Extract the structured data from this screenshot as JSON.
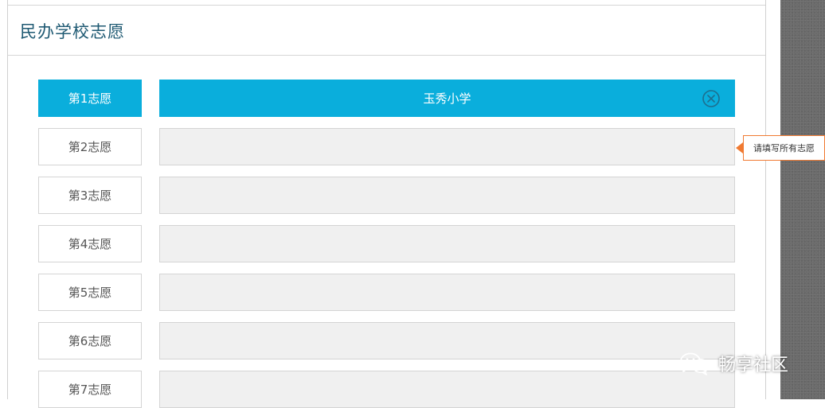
{
  "section": {
    "title": "民办学校志愿"
  },
  "wishes": [
    {
      "label": "第1志愿",
      "value": "玉秀小学",
      "active": true
    },
    {
      "label": "第2志愿",
      "value": "",
      "active": false
    },
    {
      "label": "第3志愿",
      "value": "",
      "active": false
    },
    {
      "label": "第4志愿",
      "value": "",
      "active": false
    },
    {
      "label": "第5志愿",
      "value": "",
      "active": false
    },
    {
      "label": "第6志愿",
      "value": "",
      "active": false
    },
    {
      "label": "第7志愿",
      "value": "",
      "active": false
    }
  ],
  "validation": {
    "message": "请填写所有志愿"
  },
  "watermark": {
    "text": "畅享社区",
    "icon": "wechat-icon"
  },
  "colors": {
    "accent": "#0aaedc",
    "title": "#1f5a73",
    "warning": "#f07a32",
    "empty_field": "#f0f0f0"
  }
}
